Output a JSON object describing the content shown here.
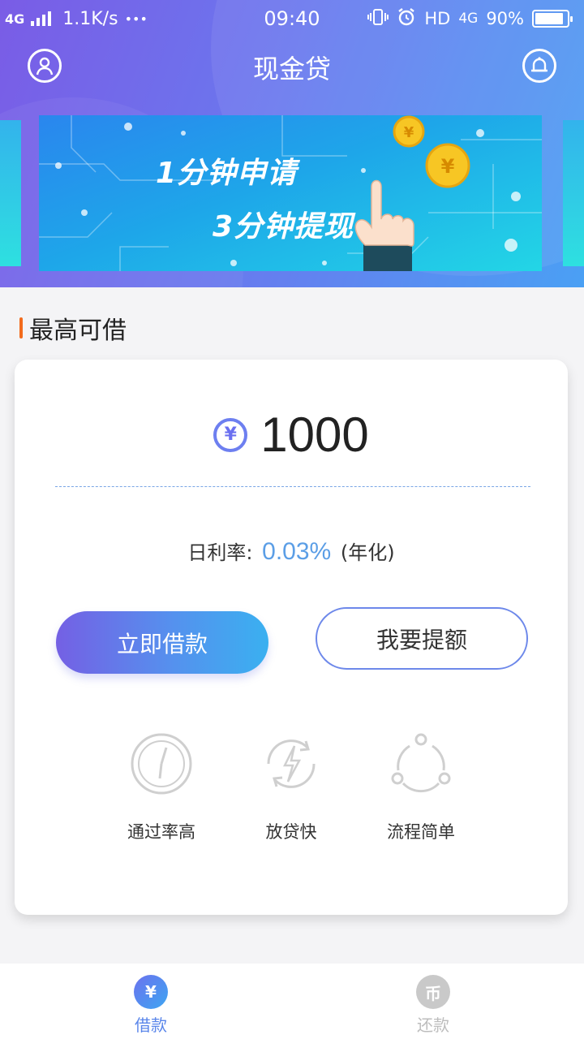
{
  "status_bar": {
    "network": "4G",
    "speed": "1.1K/s",
    "dots": "•••",
    "time": "09:40",
    "hd": "HD",
    "network_right": "4G",
    "battery_text": "90%",
    "battery_level": 0.9
  },
  "header": {
    "title": "现金贷",
    "left_icon": "user-avatar-icon",
    "right_icon": "bell-icon"
  },
  "banner": {
    "line1": "1分钟申请",
    "line2": "3分钟提现"
  },
  "section": {
    "title": "最高可借"
  },
  "loan_card": {
    "currency_symbol": "¥",
    "amount": "1000",
    "rate_label": "日利率:",
    "rate_value": "0.03%",
    "rate_suffix": "(年化)",
    "primary_button": "立即借款",
    "secondary_button": "我要提额"
  },
  "features": [
    {
      "label": "通过率高",
      "icon": "gauge-icon"
    },
    {
      "label": "放贷快",
      "icon": "lightning-refresh-icon"
    },
    {
      "label": "流程简单",
      "icon": "process-circle-icon"
    }
  ],
  "tabs": [
    {
      "label": "借款",
      "icon_glyph": "¥",
      "active": true
    },
    {
      "label": "还款",
      "icon_glyph": "币",
      "active": false
    }
  ],
  "colors": {
    "accent": "#5a86ea",
    "orange_marker": "#f26b1d",
    "rate_blue": "#5b9ee6"
  }
}
